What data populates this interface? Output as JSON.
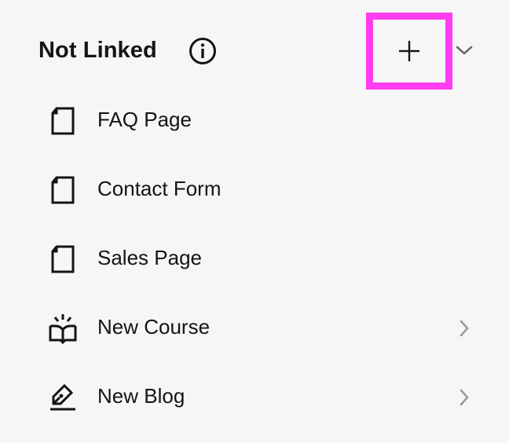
{
  "section": {
    "title": "Not Linked",
    "info_icon": "info-circle-icon",
    "add_icon": "plus-icon",
    "collapse_icon": "chevron-down-icon",
    "highlight_color": "#ff3df0"
  },
  "items": [
    {
      "label": "FAQ Page",
      "icon": "page-icon",
      "has_submenu": false
    },
    {
      "label": "Contact Form",
      "icon": "page-icon",
      "has_submenu": false
    },
    {
      "label": "Sales Page",
      "icon": "page-icon",
      "has_submenu": false
    },
    {
      "label": "New Course",
      "icon": "course-book-icon",
      "has_submenu": true
    },
    {
      "label": "New Blog",
      "icon": "blog-pen-icon",
      "has_submenu": true
    }
  ]
}
